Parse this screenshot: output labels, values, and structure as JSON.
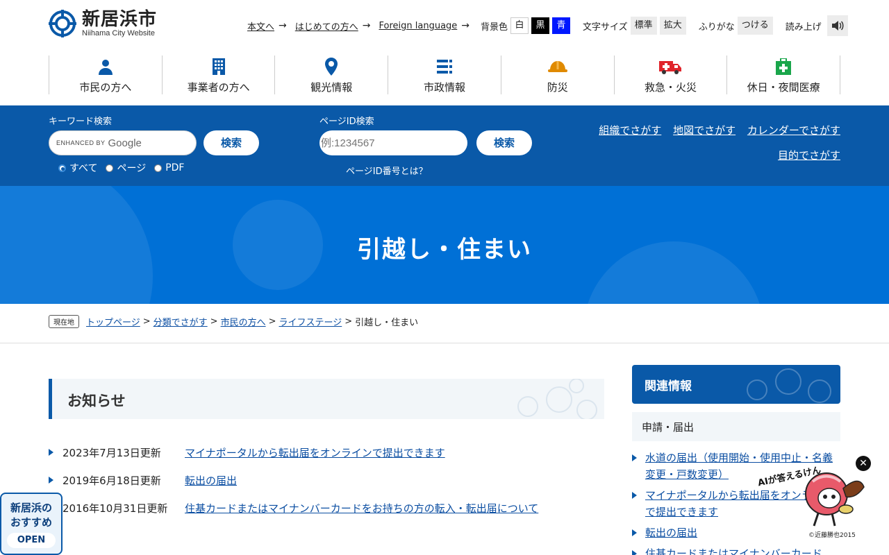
{
  "header": {
    "site_name": "新居浜市",
    "site_sub": "Niihama City Website",
    "links": [
      {
        "label": "本文へ"
      },
      {
        "label": "はじめての方へ"
      },
      {
        "label": "Foreign language"
      }
    ],
    "arrow": "→",
    "bg_label": "背景色",
    "bg_options": [
      "白",
      "黒",
      "青"
    ],
    "size_label": "文字サイズ",
    "size_options": [
      "標準",
      "拡大"
    ],
    "furigana_label": "ふりがな",
    "furigana_button": "つける",
    "read_label": "読み上げ"
  },
  "gnav": [
    {
      "label": "市民の方へ",
      "icon": "person-icon",
      "color": "#0a59a8"
    },
    {
      "label": "事業者の方へ",
      "icon": "building-icon",
      "color": "#0a59a8"
    },
    {
      "label": "観光情報",
      "icon": "map-pin-icon",
      "color": "#0a59a8"
    },
    {
      "label": "市政情報",
      "icon": "list-icon",
      "color": "#0a59a8"
    },
    {
      "label": "防災",
      "icon": "helmet-icon",
      "color": "#e08a00"
    },
    {
      "label": "救急・火災",
      "icon": "ambulance-icon",
      "color": "#e0242b"
    },
    {
      "label": "休日・夜間医療",
      "icon": "first-aid-icon",
      "color": "#1aa64b"
    }
  ],
  "search": {
    "keyword_title": "キーワード検索",
    "enhanced_by": "ENHANCED BY",
    "google": "Google",
    "button": "検索",
    "radios": [
      {
        "label": "すべて",
        "checked": true
      },
      {
        "label": "ページ",
        "checked": false
      },
      {
        "label": "PDF",
        "checked": false
      }
    ],
    "pageid_title": "ページID検索",
    "pageid_placeholder": "例:1234567",
    "pageid_button": "検索",
    "pageid_help": "ページID番号とは？",
    "find_links": [
      "組織でさがす",
      "地図でさがす",
      "カレンダーでさがす",
      "目的でさがす"
    ]
  },
  "hero": {
    "title": "引越し・住まい"
  },
  "breadcrumb": {
    "here": "現在地",
    "items": [
      "トップページ",
      "分類でさがす",
      "市民の方へ",
      "ライフステージ"
    ],
    "separator": ">",
    "current": "引越し・住まい"
  },
  "notices": {
    "heading": "お知らせ",
    "items": [
      {
        "date": "2023年7月13日更新",
        "title": "マイナポータルから転出届をオンラインで提出できます"
      },
      {
        "date": "2019年6月18日更新",
        "title": "転出の届出"
      },
      {
        "date": "2016年10月31日更新",
        "title": "住基カードまたはマイナンバーカードをお持ちの方の転入・転出届について"
      }
    ]
  },
  "side": {
    "heading": "関連情報",
    "subheading": "申請・届出",
    "links": [
      "水道の届出（使用開始・使用中止・名義変更・戸数変更）",
      "マイナポータルから転出届をオンラインで提出できます",
      "転出の届出",
      "住基カードまたはマイナンバーカード"
    ]
  },
  "recommend": {
    "line1": "新居浜の",
    "line2": "おすすめ",
    "open": "OPEN"
  },
  "ai": {
    "title": "AIが答えるけん",
    "close": "✕",
    "copyright": "©近藤勝也2015"
  },
  "colors": {
    "primary": "#0a59a8",
    "hero": "#0070d6"
  }
}
